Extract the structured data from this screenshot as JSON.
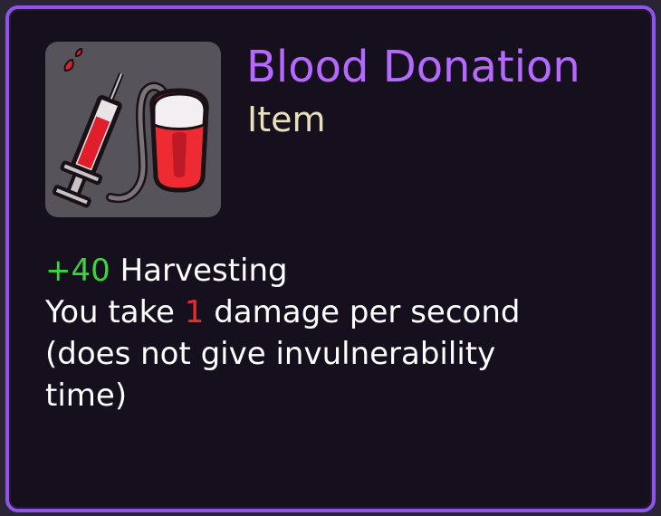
{
  "item": {
    "name": "Blood Donation",
    "type": "Item",
    "icon": "blood-bag-syringe-icon"
  },
  "effects": {
    "line1": {
      "value": "+40",
      "text": " Harvesting"
    },
    "line2": {
      "prefix": "You take ",
      "value": "1",
      "suffix": " damage per second"
    },
    "line3": "(does not give invulnerability",
    "line4": "time)"
  },
  "colors": {
    "border": "#8f55e8",
    "title": "#b669ff",
    "subtitle": "#e9dfb8",
    "positive": "#38d63a",
    "negative": "#f02a2a"
  }
}
